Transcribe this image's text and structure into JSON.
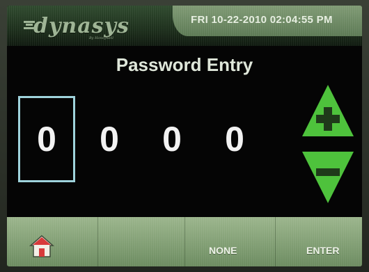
{
  "header": {
    "logo_text": "dynasys",
    "logo_sub": "By Honeywell",
    "datetime": "FRI 10-22-2010 02:04:55 PM"
  },
  "title": "Password Entry",
  "password": {
    "digits": [
      "0",
      "0",
      "0",
      "0"
    ],
    "active_index": 0
  },
  "controls": {
    "increment_icon": "plus-icon",
    "decrement_icon": "minus-icon",
    "accent_color": "#4ec23c"
  },
  "footer": {
    "home_icon": "home-icon",
    "none_label": "NONE",
    "enter_label": "ENTER"
  }
}
